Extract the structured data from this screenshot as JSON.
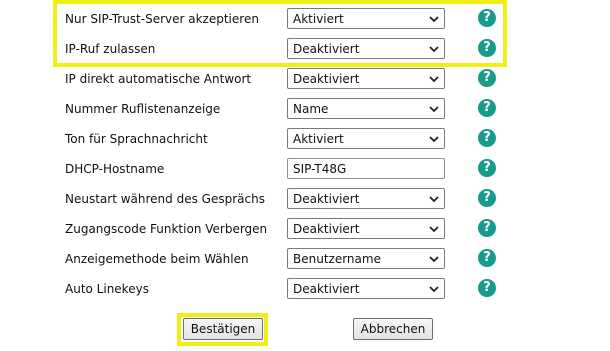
{
  "settings": [
    {
      "label": "Nur SIP-Trust-Server akzeptieren",
      "value": "Aktiviert",
      "control": "select"
    },
    {
      "label": "IP-Ruf zulassen",
      "value": "Deaktiviert",
      "control": "select"
    },
    {
      "label": "IP direkt automatische Antwort",
      "value": "Deaktiviert",
      "control": "select"
    },
    {
      "label": "Nummer Ruflistenanzeige",
      "value": "Name",
      "control": "select"
    },
    {
      "label": "Ton für Sprachnachricht",
      "value": "Aktiviert",
      "control": "select"
    },
    {
      "label": "DHCP-Hostname",
      "value": "SIP-T48G",
      "control": "input"
    },
    {
      "label": "Neustart während des Gesprächs",
      "value": "Deaktiviert",
      "control": "select"
    },
    {
      "label": "Zugangscode Funktion Verbergen",
      "value": "Deaktiviert",
      "control": "select"
    },
    {
      "label": "Anzeigemethode beim Wählen",
      "value": "Benutzername",
      "control": "select"
    },
    {
      "label": "Auto Linekeys",
      "value": "Deaktiviert",
      "control": "select"
    }
  ],
  "help_glyph": "?",
  "buttons": {
    "confirm": "Bestätigen",
    "cancel": "Abbrechen"
  },
  "colors": {
    "highlight": "#f1ee13",
    "help_icon": "#169b8d"
  }
}
